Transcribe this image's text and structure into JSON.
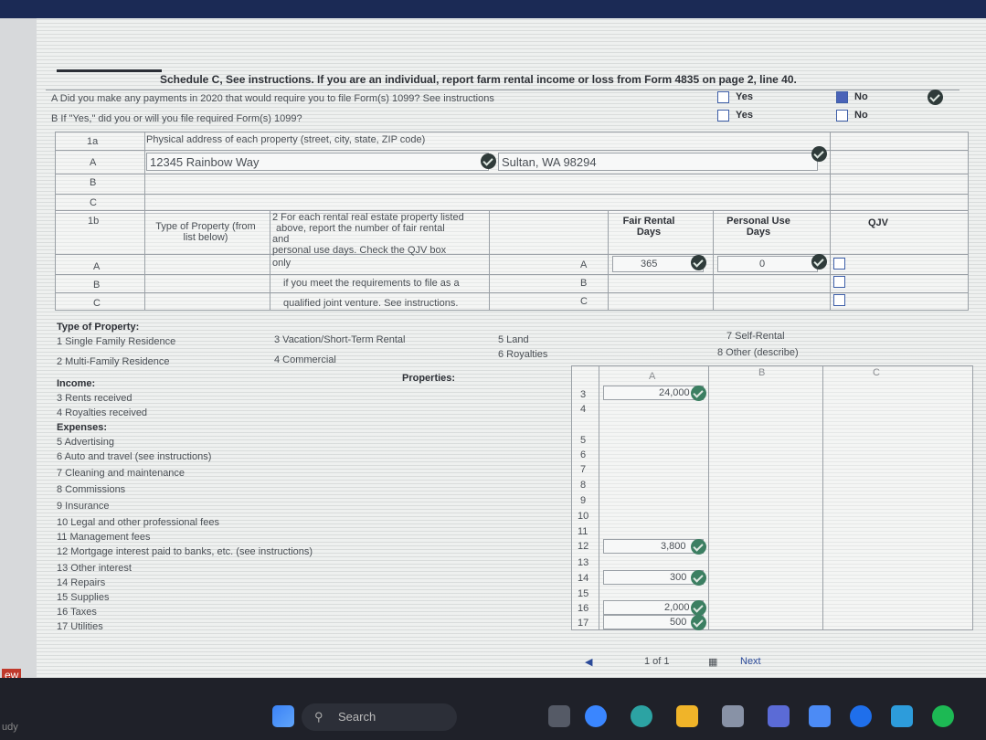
{
  "schedule": {
    "title": "Schedule C, See instructions. If you are an individual, report farm rental income or loss from Form 4835 on page 2, line 40.",
    "qa_label": "A Did you make any payments in 2020 that would require you to file Form(s) 1099? See instructions",
    "qb_label": "B If \"Yes,\" did you or will you file required Form(s) 1099?",
    "yes": "Yes",
    "no": "No"
  },
  "property_address": {
    "row_1a": "1a",
    "header": "Physical address of each property (street, city, state, ZIP code)",
    "rows": [
      "A",
      "B",
      "C"
    ],
    "a_street": "12345 Rainbow Way",
    "a_city": "Sultan, WA 98294"
  },
  "section_1b": {
    "num": "1b",
    "type_label": "Type of Property (from list below)",
    "instructions": [
      "2 For each rental real estate property listed",
      "above, report the number of fair rental",
      "and",
      "personal use days. Check the QJV box",
      "only",
      "if you meet the requirements to file as a",
      "qualified joint venture. See instructions."
    ],
    "rows": [
      "A",
      "B",
      "C"
    ],
    "fair_rental_header": "Fair Rental Days",
    "personal_use_header": "Personal Use Days",
    "qjv_header": "QJV",
    "a_fair_days": "365",
    "a_personal_days": "0"
  },
  "types": {
    "heading": "Type of Property:",
    "items": [
      "1 Single Family Residence",
      "2 Multi-Family Residence",
      "3 Vacation/Short-Term Rental",
      "4 Commercial",
      "5 Land",
      "6 Royalties",
      "7 Self-Rental",
      "8 Other (describe)"
    ]
  },
  "income": {
    "heading": "Income:",
    "properties": "Properties:",
    "cols": [
      "A",
      "B",
      "C"
    ],
    "lines": [
      {
        "label": "3 Rents received",
        "num": "3",
        "a": "24,000"
      },
      {
        "label": "4 Royalties received",
        "num": "4",
        "a": ""
      },
      {
        "label": "Expenses:",
        "num": "",
        "a": ""
      },
      {
        "label": "5 Advertising",
        "num": "5",
        "a": ""
      },
      {
        "label": "6 Auto and travel (see instructions)",
        "num": "6",
        "a": ""
      },
      {
        "label": "7 Cleaning and maintenance",
        "num": "7",
        "a": ""
      },
      {
        "label": "8 Commissions",
        "num": "8",
        "a": ""
      },
      {
        "label": "9 Insurance",
        "num": "9",
        "a": ""
      },
      {
        "label": "10 Legal and other professional fees",
        "num": "10",
        "a": ""
      },
      {
        "label": "11 Management fees",
        "num": "11",
        "a": ""
      },
      {
        "label": "12 Mortgage interest paid to banks, etc. (see instructions)",
        "num": "12",
        "a": "3,800"
      },
      {
        "label": "13 Other interest",
        "num": "13",
        "a": ""
      },
      {
        "label": "14 Repairs",
        "num": "14",
        "a": "300"
      },
      {
        "label": "15 Supplies",
        "num": "15",
        "a": ""
      },
      {
        "label": "16 Taxes",
        "num": "16",
        "a": "2,000"
      },
      {
        "label": "17 Utilities",
        "num": "17",
        "a": "500"
      }
    ]
  },
  "pager": {
    "text": "1 of 1",
    "next": "Next"
  },
  "taskbar": {
    "search": "Search",
    "edge_text": "ew",
    "corner_text": "udy"
  },
  "colors": {
    "accent": "#3d5ea8",
    "taskbar": "#1f2129",
    "check_ok": "#3c7f62"
  }
}
